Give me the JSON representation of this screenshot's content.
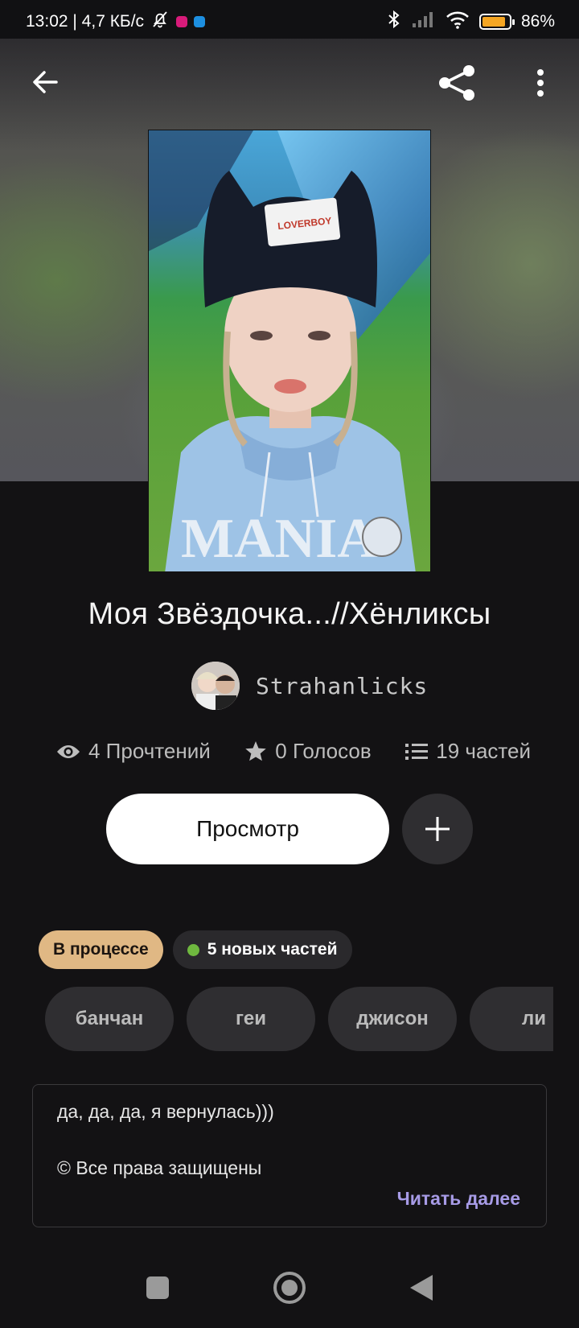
{
  "status_bar": {
    "time_and_speed": "13:02 | 4,7 КБ/с",
    "battery": "86%",
    "battery_level": 0.86
  },
  "story": {
    "title": "Моя Звёздочка...//Хёнликсы",
    "author": "Strahanlicks"
  },
  "stats": {
    "reads": "4 Прочтений",
    "votes": "0 Голосов",
    "parts": "19 частей"
  },
  "actions": {
    "view_label": "Просмотр"
  },
  "badges": {
    "status": "В процессе",
    "new_parts": "5 новых частей"
  },
  "tags": [
    "банчан",
    "геи",
    "джисон",
    "ли"
  ],
  "description": {
    "line1": "да, да, да, я вернулась)))",
    "line2": "© Все права защищены",
    "read_more": "Читать далее"
  },
  "colors": {
    "status_badge": "#e0b884",
    "new_dot": "#6fb83f",
    "read_more": "#a79be6"
  }
}
